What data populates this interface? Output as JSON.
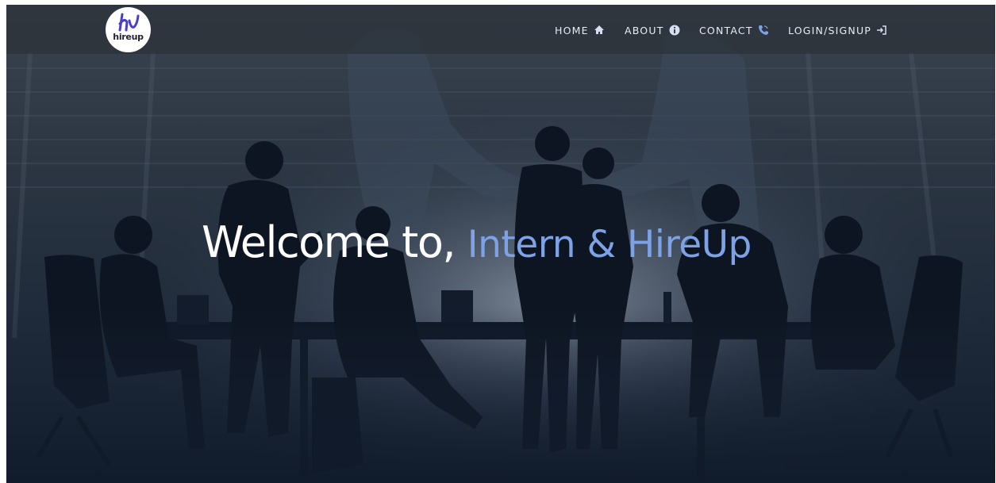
{
  "navbar": {
    "logo_text": "hireup",
    "items": [
      {
        "label": "HOME",
        "icon": "home-icon"
      },
      {
        "label": "ABOUT",
        "icon": "info-icon"
      },
      {
        "label": "CONTACT",
        "icon": "phone-icon"
      },
      {
        "label": "LOGIN/SIGNUP",
        "icon": "login-icon"
      }
    ]
  },
  "hero": {
    "headline_main": "Welcome to,",
    "headline_accent": "Intern & HireUp"
  },
  "colors": {
    "accent": "#7ea2e6",
    "logo_purple": "#4a3fc4",
    "nav_text": "#e9ecf1"
  }
}
